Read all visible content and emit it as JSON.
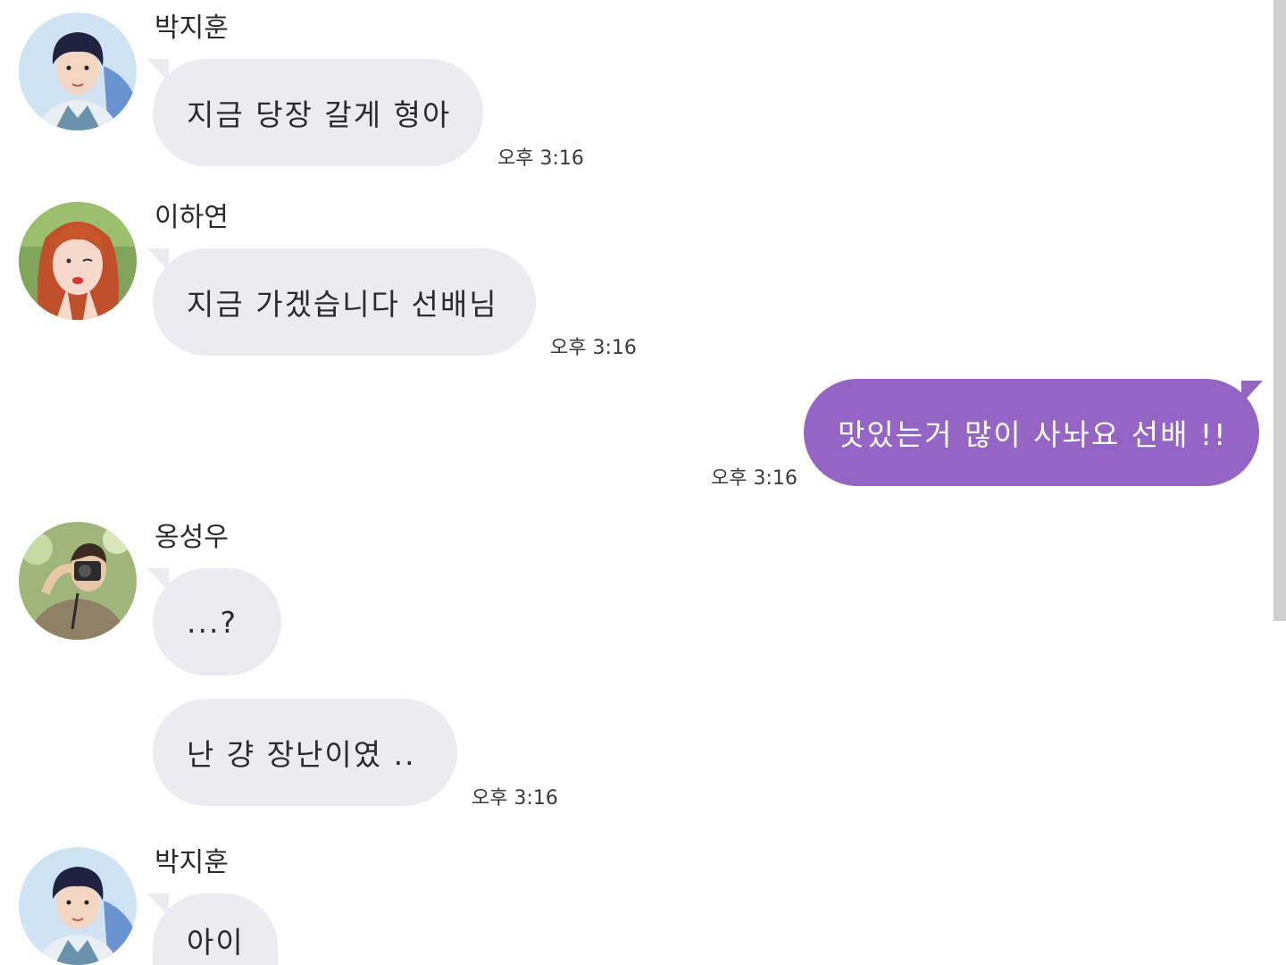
{
  "messages": [
    {
      "sender": "박지훈",
      "text": "지금 당장 갈게 형아",
      "time": "오후 3:16"
    },
    {
      "sender": "이하연",
      "text": "지금 가겠습니다 선배님",
      "time": "오후 3:16"
    },
    {
      "sender": "me",
      "text": "맛있는거 많이 사놔요 선배 !!",
      "time": "오후 3:16"
    },
    {
      "sender": "옹성우",
      "text": "...?"
    },
    {
      "text": "난 걍 장난이였 ..",
      "time": "오후 3:16"
    },
    {
      "sender": "박지훈",
      "text": "아이"
    }
  ],
  "colors": {
    "incoming_bubble": "#ececf0",
    "outgoing_bubble": "#9465c4",
    "background": "#ffffff"
  },
  "avatars": [
    "avatar-photo-park-jihoon",
    "avatar-photo-lee-hayeon",
    "avatar-photo-ong-seongwu"
  ]
}
